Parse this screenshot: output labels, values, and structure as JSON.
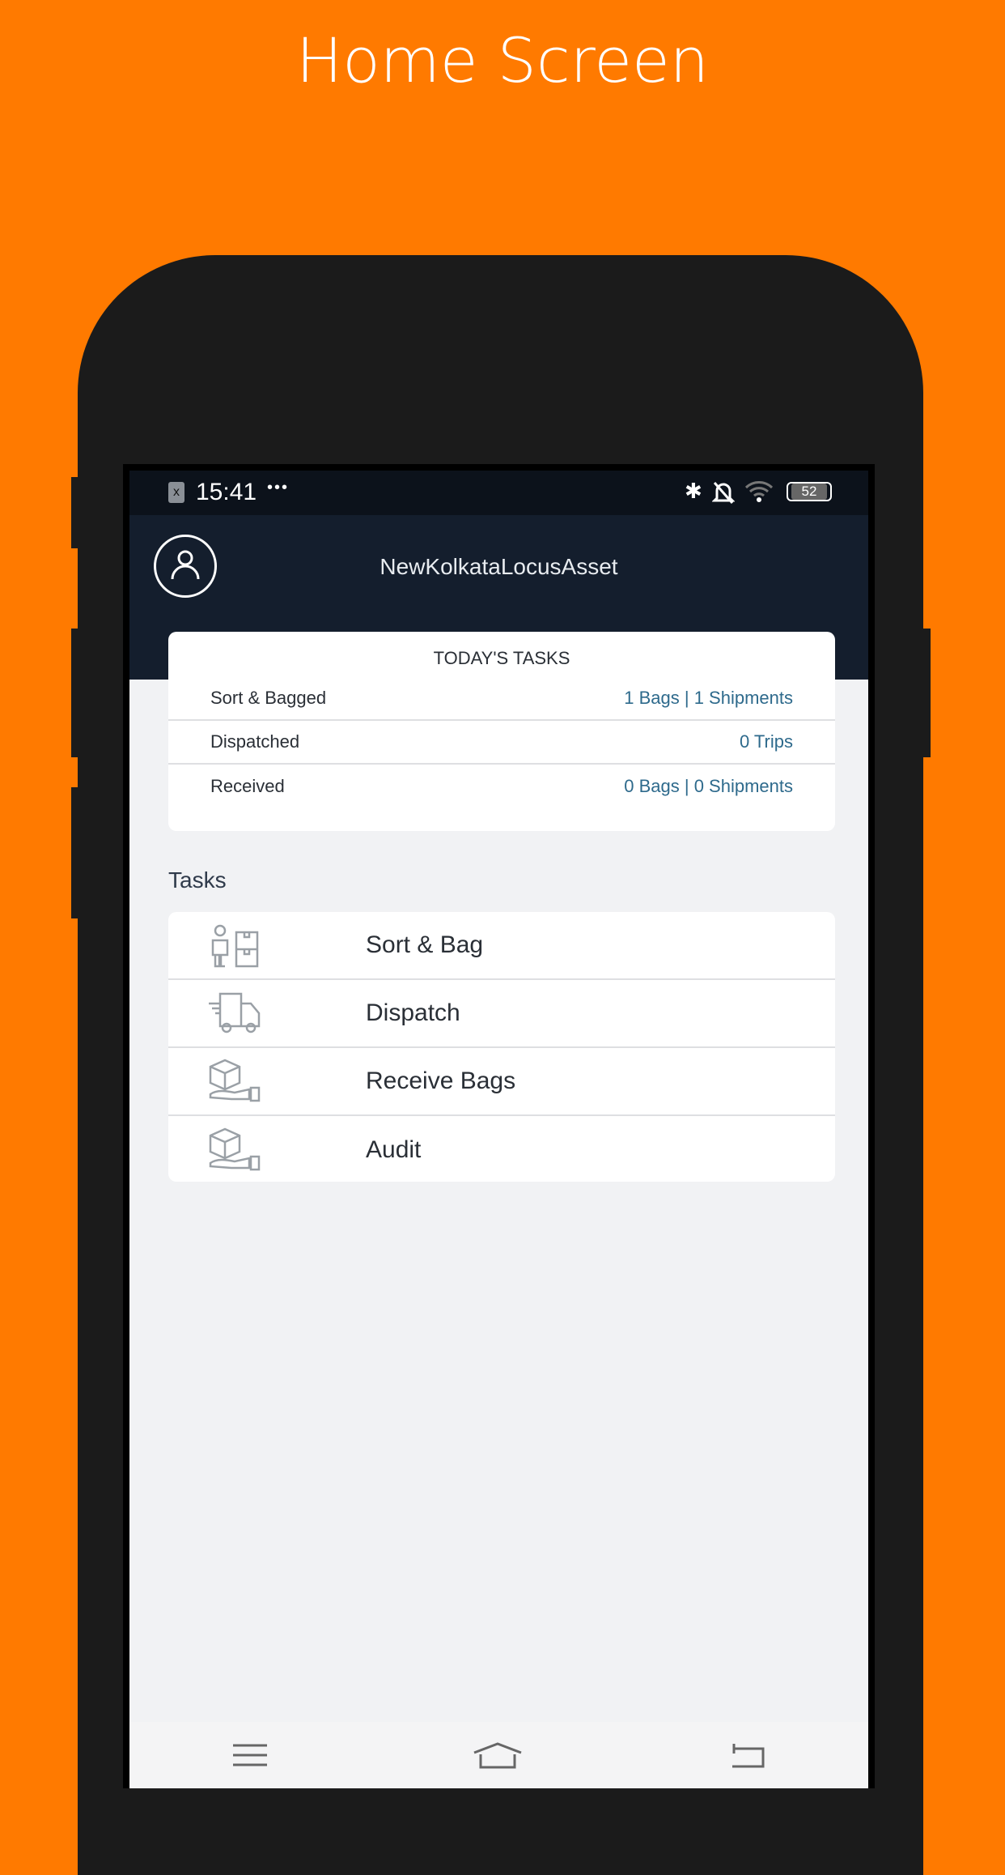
{
  "headline": "Home Screen",
  "status_bar": {
    "time": "15:41",
    "dots": "•••",
    "battery": "52",
    "icons": [
      "sim-x-icon",
      "bluetooth-icon",
      "bell-off-icon",
      "wifi-icon",
      "battery-icon"
    ]
  },
  "header": {
    "title": "NewKolkataLocusAsset",
    "icon": "user-avatar-icon"
  },
  "todays_tasks": {
    "title": "TODAY'S TASKS",
    "rows": [
      {
        "label": "Sort & Bagged",
        "value": "1 Bags | 1 Shipments"
      },
      {
        "label": "Dispatched",
        "value": "0 Trips"
      },
      {
        "label": "Received",
        "value": "0 Bags | 0 Shipments"
      }
    ]
  },
  "tasks": {
    "heading": "Tasks",
    "items": [
      {
        "label": "Sort & Bag",
        "icon": "worker-boxes-icon"
      },
      {
        "label": "Dispatch",
        "icon": "delivery-truck-icon"
      },
      {
        "label": "Receive Bags",
        "icon": "hand-box-icon"
      },
      {
        "label": "Audit",
        "icon": "hand-box-icon"
      }
    ]
  },
  "nav": [
    "menu-icon",
    "home-icon",
    "back-icon"
  ],
  "colors": {
    "background": "#FF7A00",
    "header": "#141e2d",
    "accent_text": "#2e6a8c"
  }
}
